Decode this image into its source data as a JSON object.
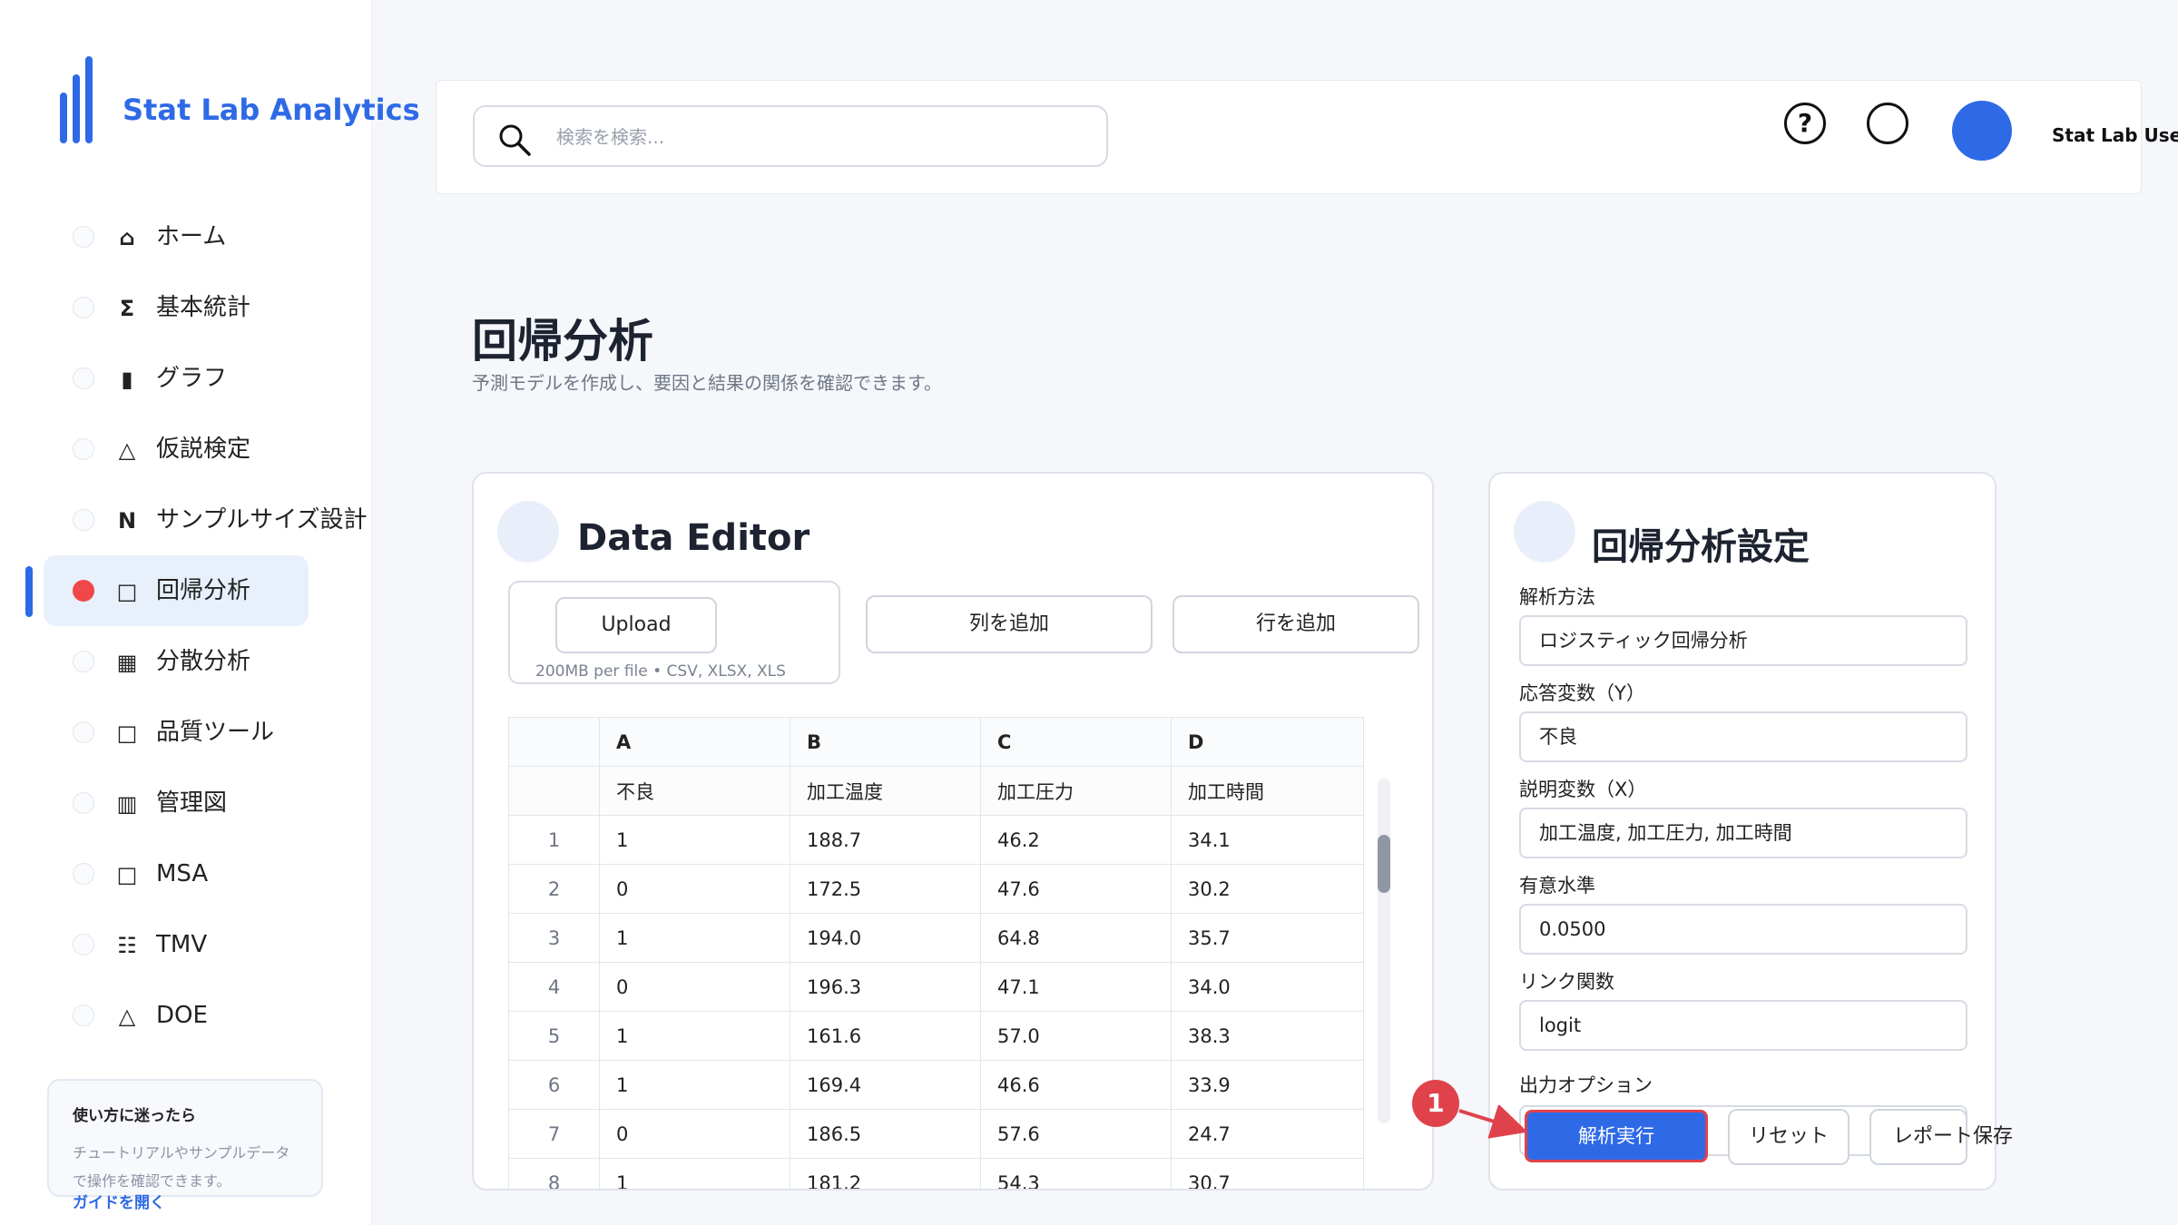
{
  "app": {
    "title": "Stat Lab Analytics"
  },
  "sidebar": {
    "items": [
      {
        "icon": "⌂",
        "label": "ホーム"
      },
      {
        "icon": "Σ",
        "label": "基本統計"
      },
      {
        "icon": "▮",
        "label": "グラフ"
      },
      {
        "icon": "△",
        "label": "仮説検定"
      },
      {
        "icon": "N",
        "label": "サンプルサイズ設計"
      },
      {
        "icon": "□",
        "label": "回帰分析"
      },
      {
        "icon": "▦",
        "label": "分散分析"
      },
      {
        "icon": "□",
        "label": "品質ツール"
      },
      {
        "icon": "▥",
        "label": "管理図"
      },
      {
        "icon": "□",
        "label": "MSA"
      },
      {
        "icon": "☷",
        "label": "TMV"
      },
      {
        "icon": "△",
        "label": "DOE"
      }
    ],
    "active_label": "回帰分析",
    "help": {
      "title": "使い方に迷ったら",
      "text": "チュートリアルやサンプルデータで操作を確認できます。",
      "link": "ガイドを開く"
    }
  },
  "header": {
    "search_placeholder": "検索を検索...",
    "help_icon": "?",
    "user_name": "Stat Lab User"
  },
  "page": {
    "title": "回帰分析",
    "subtitle": "予測モデルを作成し、要因と結果の関係を確認できます。"
  },
  "editor": {
    "title": "Data Editor",
    "upload_label": "Upload",
    "upload_hint": "200MB per file • CSV, XLSX, XLS",
    "add_column_label": "列を追加",
    "add_row_label": "行を追加",
    "columns": [
      "A",
      "B",
      "C",
      "D"
    ],
    "column_names": [
      "不良",
      "加工温度",
      "加工圧力",
      "加工時間"
    ],
    "rows": [
      {
        "index": "1",
        "cells": [
          "1",
          "188.7",
          "46.2",
          "34.1"
        ]
      },
      {
        "index": "2",
        "cells": [
          "0",
          "172.5",
          "47.6",
          "30.2"
        ]
      },
      {
        "index": "3",
        "cells": [
          "1",
          "194.0",
          "64.8",
          "35.7"
        ]
      },
      {
        "index": "4",
        "cells": [
          "0",
          "196.3",
          "47.1",
          "34.0"
        ]
      },
      {
        "index": "5",
        "cells": [
          "1",
          "161.6",
          "57.0",
          "38.3"
        ]
      },
      {
        "index": "6",
        "cells": [
          "1",
          "169.4",
          "46.6",
          "33.9"
        ]
      },
      {
        "index": "7",
        "cells": [
          "0",
          "186.5",
          "57.6",
          "24.7"
        ]
      },
      {
        "index": "8",
        "cells": [
          "1",
          "181.2",
          "54.3",
          "30.7"
        ]
      }
    ]
  },
  "settings": {
    "title": "回帰分析設定",
    "fields": [
      {
        "label": "解析方法",
        "value": "ロジスティック回帰分析"
      },
      {
        "label": "応答変数（Y）",
        "value": "不良"
      },
      {
        "label": "説明変数（X）",
        "value": "加工温度, 加工圧力, 加工時間"
      },
      {
        "label": "有意水準",
        "value": "0.0500"
      },
      {
        "label": "リンク関数",
        "value": "logit"
      }
    ],
    "output_label": "出力オプション",
    "run_label": "解析実行",
    "reset_label": "リセット",
    "save_label": "レポート保存"
  },
  "annotation": {
    "number": "1"
  },
  "colors": {
    "accent": "#2f6ae6",
    "highlight": "#e0424b",
    "active_bg": "#e8f0fc"
  }
}
